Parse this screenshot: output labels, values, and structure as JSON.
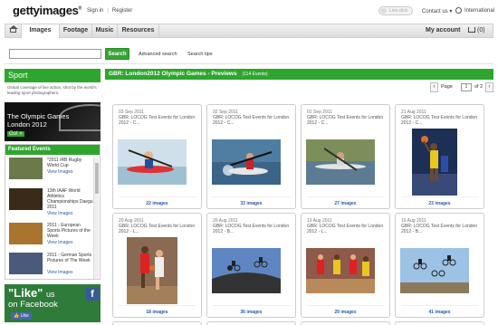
{
  "header": {
    "logo_text": "gettyimages",
    "logo_mark": "®",
    "sign_in": "Sign in",
    "separator": "|",
    "register": "Register",
    "live_click": "Live click",
    "contact": "Contact us ▾",
    "international": "International"
  },
  "nav": {
    "home_icon": "home-icon",
    "tabs": [
      "Images",
      "Footage",
      "Music",
      "Resources"
    ],
    "my_account": "My account",
    "cart_count": "(0)"
  },
  "search": {
    "placeholder": "",
    "button": "Search",
    "advanced": "Advanced search",
    "tips": "Search tips"
  },
  "sidebar": {
    "title": "Sport",
    "description": "Global coverage of live action, shot by the world's leading sport photographers.",
    "banner_line1": "The Olympic Games",
    "banner_line2": "London 2012",
    "banner_go": "Go! »",
    "featured_title": "Featured Events",
    "featured": [
      {
        "title": "*2011 IRB Rugby World Cup",
        "link": "View Images"
      },
      {
        "title": "13th IAAF World Athletics Championships Daegu 2011",
        "link": "View Images"
      },
      {
        "title": "2011 - European Sports Pictures of the Week",
        "link": "View Images"
      },
      {
        "title": "2011 - German Sports Pictures of The Week",
        "link": "View Images"
      }
    ],
    "fb_like": "\"Like\"",
    "fb_us": "us",
    "fb_on": "on Facebook",
    "fb_button": "👍 Like"
  },
  "results": {
    "title": "GBR: London2012 Olympic Games - Previews",
    "count": "(114 Events)",
    "page_label": "Page",
    "page_value": "1",
    "page_of": "of 2",
    "prev": "‹",
    "next": "›",
    "cards": [
      {
        "date": "03 Sep 2011",
        "title": "GBR: LOCOG Test Events for London 2012 - C...",
        "count": "22 images",
        "photo": "#a8c4d4"
      },
      {
        "date": "02 Sep 2011",
        "title": "GBR: LOCOG Test Events for London 2012 - C...",
        "count": "33 images",
        "photo": "#5b88a6"
      },
      {
        "date": "01 Sep 2011",
        "title": "GBR: LOCOG Test Events for London 2012 - C...",
        "count": "27 images",
        "photo": "#8a9a6a"
      },
      {
        "date": "21 Aug 2011",
        "title": "GBR: LOCOG Test Events for London 2012 - C...",
        "count": "23 images",
        "photo": "#2a3f6a"
      },
      {
        "date": "20 Aug 2011",
        "title": "GBR: LOCOG Test Events for London 2012 - L...",
        "count": "18 images",
        "photo": "#9a7860"
      },
      {
        "date": "20 Aug 2011",
        "title": "GBR: LOCOG Test Events for London 2012 - B...",
        "count": "36 images",
        "photo": "#6a8ab6"
      },
      {
        "date": "19 Aug 2011",
        "title": "GBR: LOCOG Test Events for London 2012 - L...",
        "count": "29 images",
        "photo": "#b46a5a"
      },
      {
        "date": "19 Aug 2011",
        "title": "GBR: LOCOG Test Events for London 2012 - B...",
        "count": "41 images",
        "photo": "#8ab0d6"
      }
    ]
  }
}
